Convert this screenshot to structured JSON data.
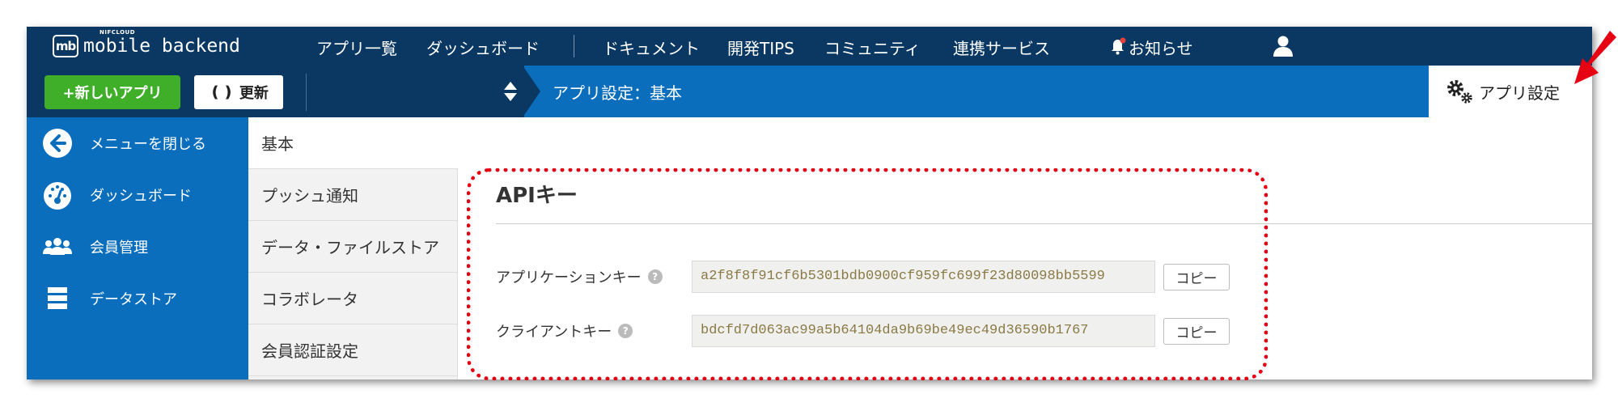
{
  "logo": {
    "small_text": "NIFCLOUD",
    "text": "mobile backend",
    "badge": "mb"
  },
  "topnav": {
    "links": [
      {
        "label": "アプリ一覧"
      },
      {
        "label": "ダッシュボード"
      },
      {
        "label": "ドキュメント"
      },
      {
        "label": "開発TIPS"
      },
      {
        "label": "コミュニティ"
      },
      {
        "label": "連携サービス"
      }
    ],
    "notifications_label": "お知らせ",
    "user_icon": "user-icon",
    "bell_icon": "bell-icon"
  },
  "subbar": {
    "new_app_label": "+新しいアプリ",
    "refresh_label": "更新",
    "breadcrumb": "アプリ設定：基本",
    "settings_tab_label": "アプリ設定"
  },
  "sidebar": {
    "items": [
      {
        "label": "メニューを閉じる",
        "icon": "arrow-left-circle-icon"
      },
      {
        "label": "ダッシュボード",
        "icon": "gauge-icon"
      },
      {
        "label": "会員管理",
        "icon": "users-icon"
      },
      {
        "label": "データストア",
        "icon": "database-icon"
      }
    ]
  },
  "settings_menu": {
    "items": [
      {
        "label": "基本",
        "active": true
      },
      {
        "label": "プッシュ通知"
      },
      {
        "label": "データ・ファイルストア"
      },
      {
        "label": "コラボレータ"
      },
      {
        "label": "会員認証設定"
      }
    ]
  },
  "api": {
    "title": "APIキー",
    "application_key": {
      "label": "アプリケーションキー",
      "help": "?",
      "value": "a2f8f8f91cf6b5301bdb0900cf959fc699f23d80098bb5599",
      "copy_label": "コピー"
    },
    "client_key": {
      "label": "クライアントキー",
      "help": "?",
      "value": "bdcfd7d063ac99a5b64104da9b69be49ec49d36590b1767",
      "copy_label": "コピー"
    }
  },
  "colors": {
    "nav_dark": "#0a3863",
    "nav_blue": "#0a6ebd",
    "green": "#3fae29",
    "annotation_red": "#e60012"
  }
}
